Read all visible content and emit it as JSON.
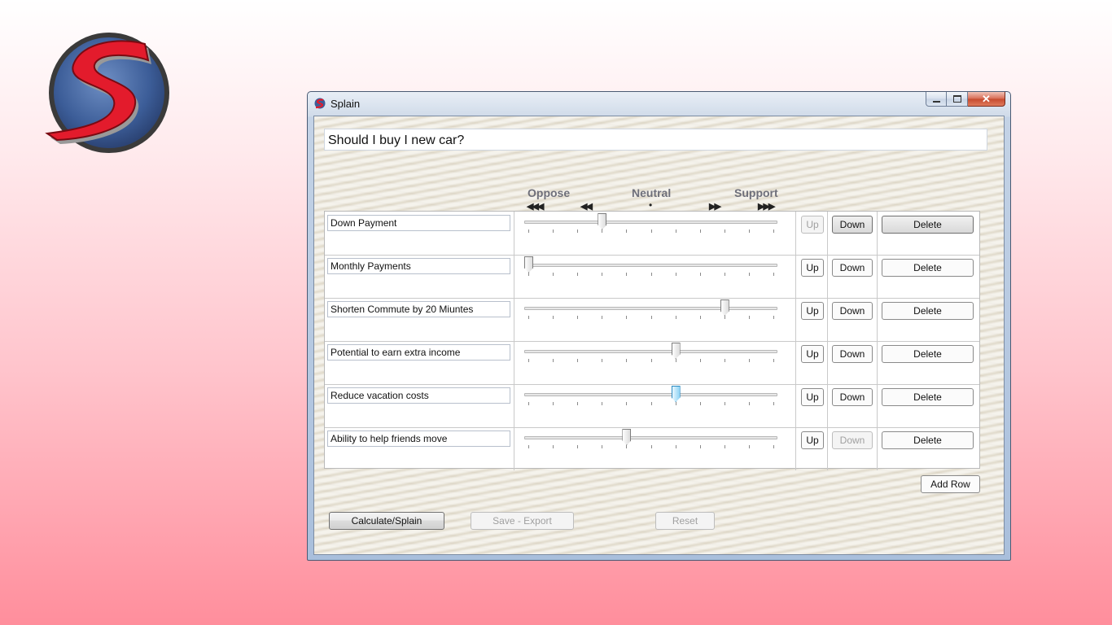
{
  "window": {
    "title": "Splain",
    "icon": "splain-app-icon",
    "caption": {
      "minimize": "minimize-icon",
      "maximize": "maximize-icon",
      "close": "close-icon"
    }
  },
  "question": {
    "value": "Should I buy I new car?"
  },
  "scale": {
    "oppose": "Oppose",
    "neutral": "Neutral",
    "support": "Support",
    "strong_oppose_arrow": "◀◀◀",
    "oppose_arrow": "◀◀",
    "neutral_marker": "•",
    "support_arrow": "▶▶",
    "strong_support_arrow": "▶▶▶"
  },
  "slider_range": {
    "min": 0,
    "max": 10
  },
  "rows": [
    {
      "label": "Down Payment",
      "value": 3,
      "up": "Up",
      "down": "Down",
      "delete": "Delete",
      "up_enabled": false,
      "down_enabled": true,
      "focused": false
    },
    {
      "label": "Monthly Payments",
      "value": 0,
      "up": "Up",
      "down": "Down",
      "delete": "Delete",
      "up_enabled": true,
      "down_enabled": true,
      "focused": false
    },
    {
      "label": "Shorten Commute by 20 Miuntes",
      "value": 8,
      "up": "Up",
      "down": "Down",
      "delete": "Delete",
      "up_enabled": true,
      "down_enabled": true,
      "focused": false
    },
    {
      "label": "Potential to earn extra income",
      "value": 6,
      "up": "Up",
      "down": "Down",
      "delete": "Delete",
      "up_enabled": true,
      "down_enabled": true,
      "focused": false
    },
    {
      "label": "Reduce vacation costs",
      "value": 6,
      "up": "Up",
      "down": "Down",
      "delete": "Delete",
      "up_enabled": true,
      "down_enabled": true,
      "focused": true
    },
    {
      "label": "Ability to help friends move",
      "value": 4,
      "up": "Up",
      "down": "Down",
      "delete": "Delete",
      "up_enabled": true,
      "down_enabled": false,
      "focused": false
    }
  ],
  "actions": {
    "add_row": "Add Row",
    "calculate": "Calculate/Splain",
    "save_export": "Save - Export",
    "reset": "Reset"
  },
  "colors": {
    "logo_ring": "#3d5a8c",
    "logo_s": "#e0202f",
    "slider_focus": "#2c8bc2"
  }
}
